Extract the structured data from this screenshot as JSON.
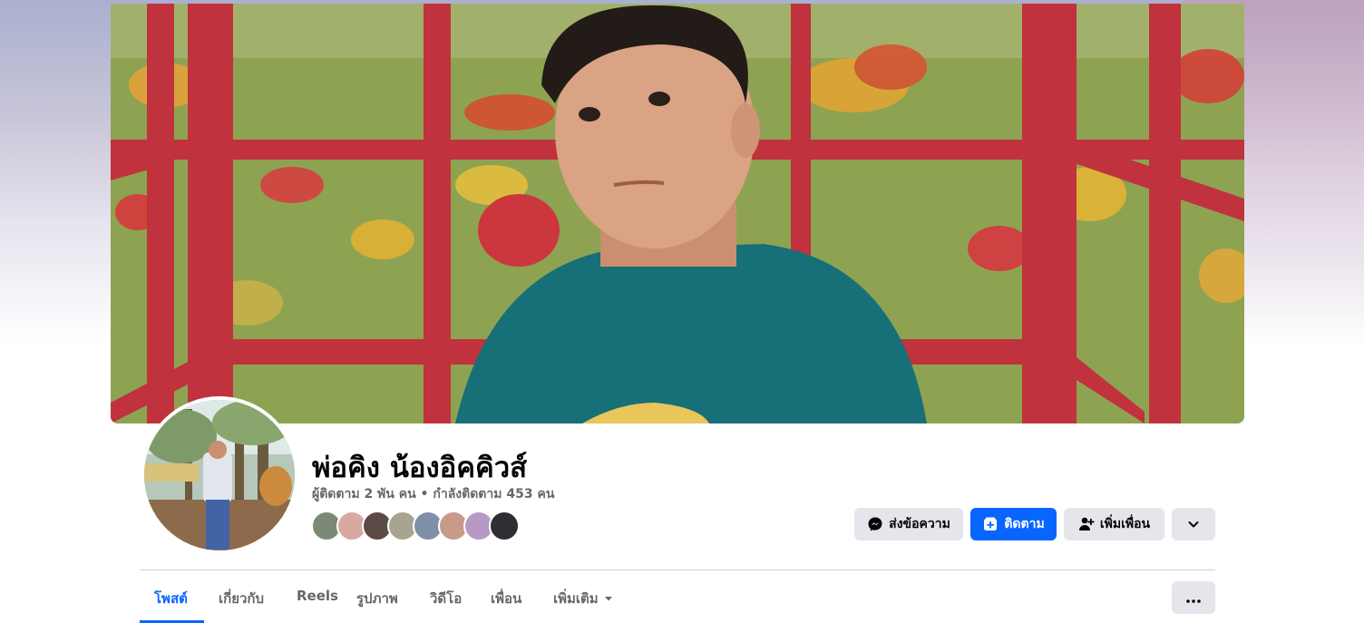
{
  "profile": {
    "name": "พ่อคิง น้องอิคคิวส์",
    "stats": "ผู้ติดตาม 2 พัน คน • กำลังติดตาม 453 คน",
    "mutual_friends": [
      {
        "icon": "friend-avatar-1",
        "color": "#7a8a74"
      },
      {
        "icon": "friend-avatar-2",
        "color": "#d8a9a0"
      },
      {
        "icon": "friend-avatar-3",
        "color": "#5b4a45"
      },
      {
        "icon": "friend-avatar-4",
        "color": "#a7a48f"
      },
      {
        "icon": "friend-avatar-5",
        "color": "#7f8fa8"
      },
      {
        "icon": "friend-avatar-6",
        "color": "#c79a8a"
      },
      {
        "icon": "friend-avatar-7",
        "color": "#b79ac4"
      },
      {
        "icon": "friend-avatar-8",
        "color": "#2f2f33"
      }
    ]
  },
  "actions": {
    "message_label": "ส่งข้อความ",
    "follow_label": "ติดตาม",
    "add_friend_label": "เพิ่มเพื่อน"
  },
  "tabs": [
    {
      "label": "โพสต์",
      "active": true
    },
    {
      "label": "เกี่ยวกับ",
      "active": false
    },
    {
      "label": "Reels",
      "active": false
    },
    {
      "label": "รูปภาพ",
      "active": false
    },
    {
      "label": "วิดีโอ",
      "active": false
    },
    {
      "label": "เพื่อน",
      "active": false
    },
    {
      "label": "เพิ่มเติม",
      "active": false
    }
  ],
  "colors": {
    "accent": "#0866ff",
    "button_grey": "#e4e6eb",
    "secondary_text": "#65676b"
  }
}
